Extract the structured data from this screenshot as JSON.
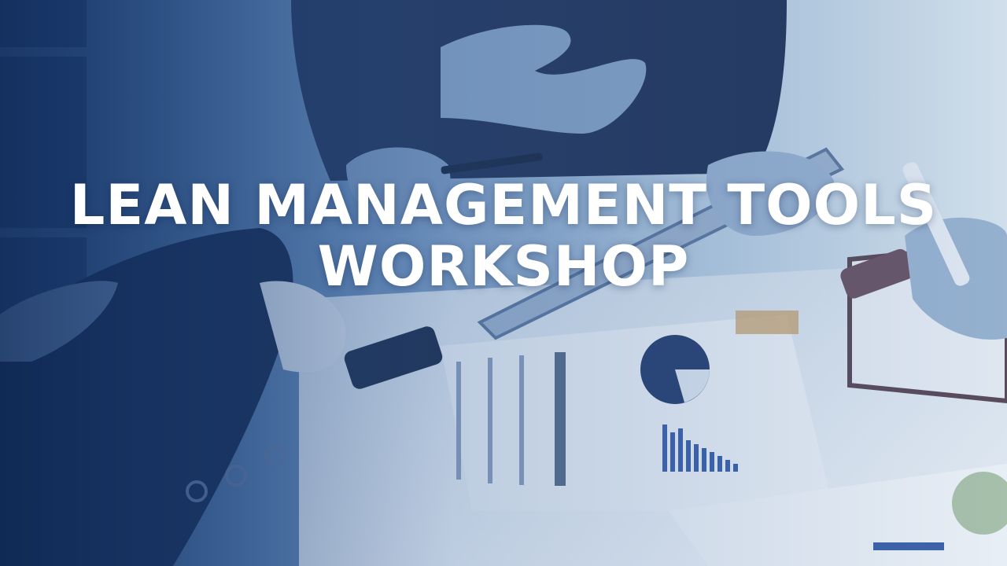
{
  "headline": {
    "line1": "LEAN MANAGEMENT TOOLS",
    "line2": "WORKSHOP"
  },
  "colors": {
    "overlay": "#2c5a9a",
    "overlay_dark": "#0f2b5a",
    "paper": "#eef3f8",
    "text": "#ffffff"
  }
}
